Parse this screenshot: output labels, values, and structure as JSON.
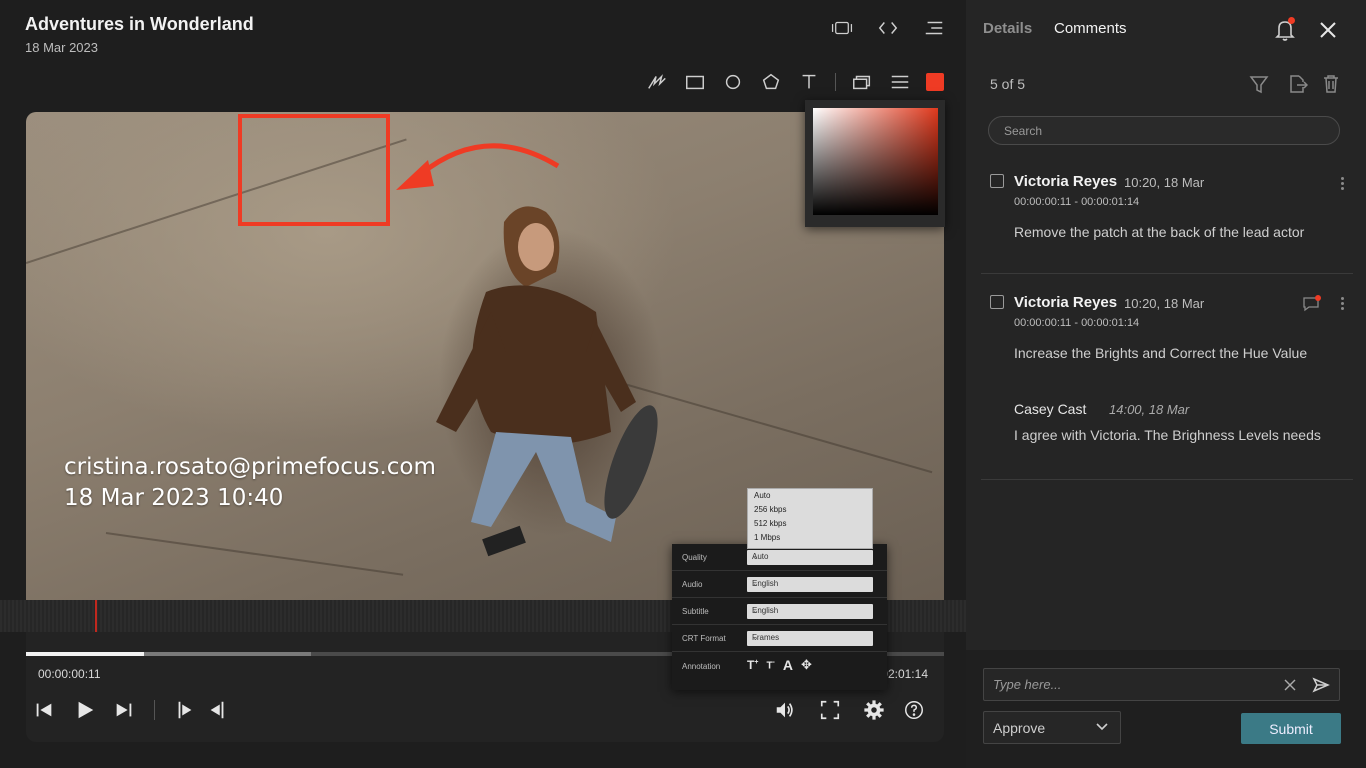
{
  "header": {
    "title": "Adventures in Wonderland",
    "date": "18 Mar 2023"
  },
  "video": {
    "watermark_email": "cristina.rosato@primefocus.com",
    "watermark_datetime": "18 Mar 2023 10:40",
    "current_time": "00:00:00:11",
    "end_time": "02:01:14",
    "progress": 0.128,
    "buffered": 0.31,
    "annotation_color": "#ef3b24"
  },
  "settings": {
    "quality_label": "Quality",
    "quality_value": "Auto",
    "audio_label": "Audio",
    "audio_value": "English",
    "subtitle_label": "Subtitle",
    "subtitle_value": "English",
    "crt_label": "CRT Format",
    "crt_value": "Frames",
    "annotation_label": "Annotation",
    "quality_options": [
      "Auto",
      "256 kbps",
      "512 kbps",
      "1 Mbps"
    ]
  },
  "panel": {
    "tab_details": "Details",
    "tab_comments": "Comments",
    "count": "5 of 5",
    "search_placeholder": "Search",
    "comments": [
      {
        "author": "Victoria Reyes",
        "time": "10:20, 18 Mar",
        "timecode": "00:00:00:11 - 00:00:01:14",
        "text": "Remove the patch at the back of the lead actor"
      },
      {
        "author": "Victoria Reyes",
        "time": "10:20, 18 Mar",
        "timecode": "00:00:00:11 - 00:00:01:14",
        "text": "Increase the Brights and Correct the Hue Value",
        "reply": {
          "author": "Casey Cast",
          "time": "14:00, 18 Mar",
          "text": "I agree with Victoria. The Brighness Levels needs"
        }
      }
    ]
  },
  "composer": {
    "placeholder": "Type here...",
    "status": "Approve",
    "submit_label": "Submit"
  }
}
